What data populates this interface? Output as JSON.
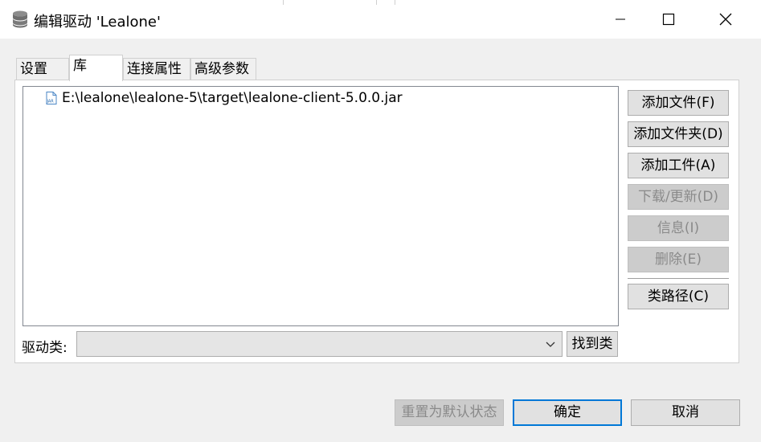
{
  "window": {
    "title": "编辑驱动 'Lealone'",
    "icon": "database-icon",
    "controls": [
      "minimize-icon",
      "maximize-icon",
      "close-icon"
    ]
  },
  "tabs": [
    {
      "label": "设置",
      "active": false
    },
    {
      "label": "库",
      "active": true
    },
    {
      "label": "连接属性",
      "active": false
    },
    {
      "label": "高级参数",
      "active": false
    }
  ],
  "library": {
    "items": [
      {
        "icon": "jar-file-icon",
        "path": "E:\\lealone\\lealone-5\\target\\lealone-client-5.0.0.jar"
      }
    ]
  },
  "side_buttons": {
    "add_file": "添加文件(F)",
    "add_folder": "添加文件夹(D)",
    "add_artifact": "添加工件(A)",
    "download_update": "下载/更新(D)",
    "info": "信息(I)",
    "delete": "删除(E)",
    "classpath": "类路径(C)"
  },
  "driver_class": {
    "label": "驱动类:",
    "value": "",
    "find_button": "找到类"
  },
  "footer": {
    "reset": "重置为默认状态",
    "ok": "确定",
    "cancel": "取消"
  },
  "colors": {
    "default_button_border": "#0078d7",
    "disabled_button_bg": "#cccccc",
    "jar_icon_blue": "#2b6cb0"
  }
}
